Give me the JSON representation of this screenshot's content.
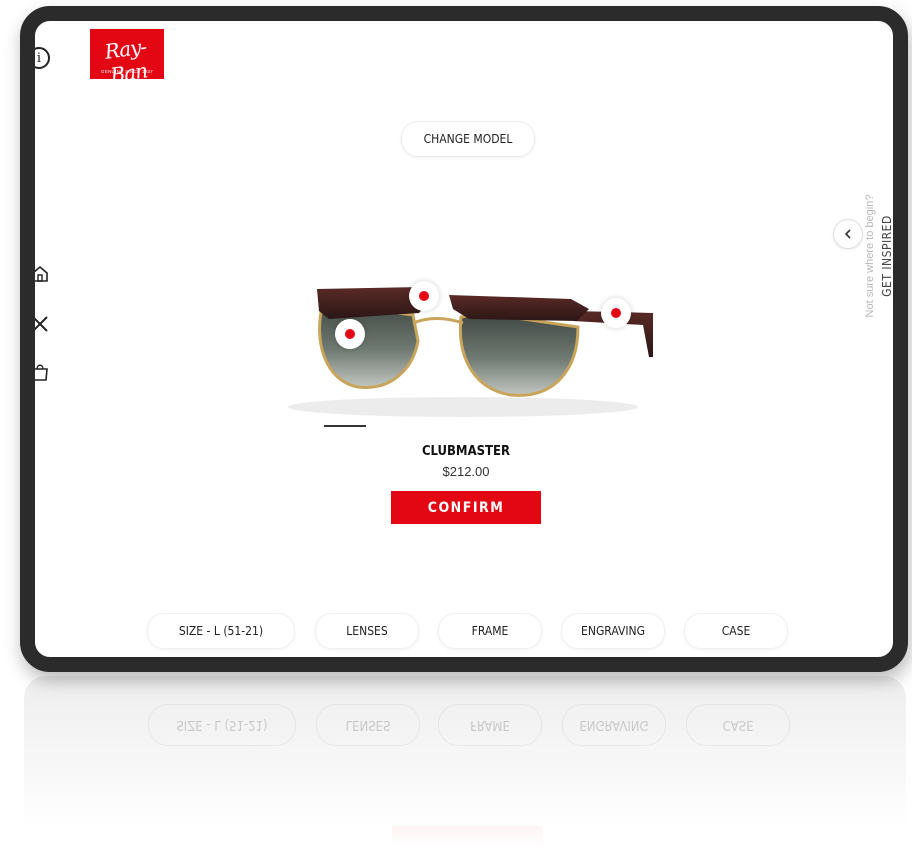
{
  "app": {
    "brand_name": "Ray-Ban",
    "brand_tagline": "GENUINE SINCE 1937",
    "brand_color": "#e30613"
  },
  "header": {
    "info_label": "i",
    "change_model_label": "CHANGE MODEL"
  },
  "sidebar": {
    "items": [
      {
        "name": "home",
        "icon": "home-icon"
      },
      {
        "name": "close",
        "icon": "close-icon"
      },
      {
        "name": "bag",
        "icon": "shopping-bag-icon"
      }
    ]
  },
  "product": {
    "name": "CLUBMASTER",
    "price": "$212.00",
    "confirm_label": "CONFIRM",
    "hotspots": [
      "lens-hotspot",
      "bridge-hotspot",
      "temple-hotspot"
    ]
  },
  "inspire": {
    "hint": "Not sure where to begin?",
    "cta": "GET INSPIRED",
    "icon": "chevron-left-icon"
  },
  "tabs": [
    {
      "label": "SIZE - L (51-21)"
    },
    {
      "label": "LENSES"
    },
    {
      "label": "FRAME"
    },
    {
      "label": "ENGRAVING"
    },
    {
      "label": "CASE"
    }
  ]
}
